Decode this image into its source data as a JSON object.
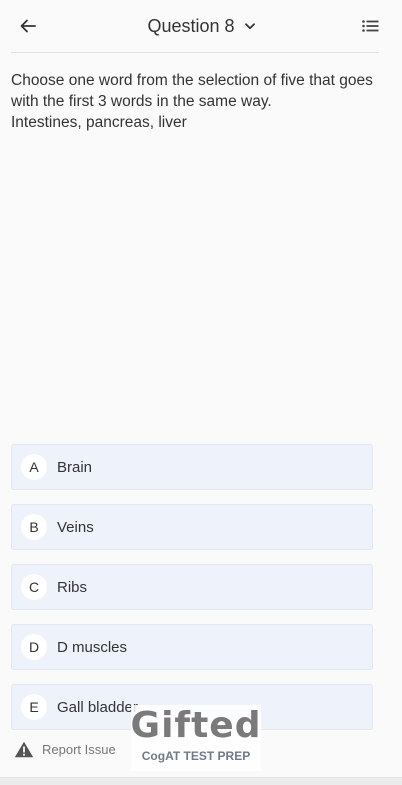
{
  "header": {
    "title": "Question 8"
  },
  "question": {
    "lines": [
      "Choose one word from the selection of five that goes with the first 3 words in the same way.",
      "Intestines, pancreas, liver"
    ]
  },
  "options": [
    {
      "letter": "A",
      "text": "Brain"
    },
    {
      "letter": "B",
      "text": "Veins"
    },
    {
      "letter": "C",
      "text": "Ribs"
    },
    {
      "letter": "D",
      "text": "D muscles"
    },
    {
      "letter": "E",
      "text": "Gall bladder"
    }
  ],
  "footer": {
    "report_label": "Report Issue"
  },
  "watermark": {
    "logo": "Gifted",
    "subtitle": "CogAT TEST PREP"
  },
  "icons": {
    "back": "arrow-left-icon",
    "title_dropdown": "chevron-down-icon",
    "menu": "list-icon",
    "report": "warning-triangle-icon"
  },
  "colors": {
    "option_background": "#eef2fa",
    "text": "#333333"
  }
}
